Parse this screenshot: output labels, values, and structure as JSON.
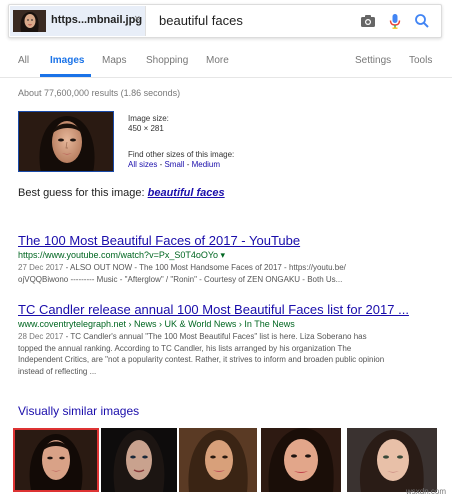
{
  "search": {
    "chip_label": "https...mbnail.jpg",
    "chip_close": "×",
    "query": "beautiful faces",
    "icons": [
      "camera-icon",
      "microphone-icon",
      "search-icon"
    ]
  },
  "tabs": [
    {
      "label": "All",
      "active": false
    },
    {
      "label": "Images",
      "active": true
    },
    {
      "label": "Maps",
      "active": false
    },
    {
      "label": "Shopping",
      "active": false
    },
    {
      "label": "More",
      "active": false
    },
    {
      "label": "Settings",
      "active": false
    },
    {
      "label": "Tools",
      "active": false
    }
  ],
  "stats": "About 77,600,000 results (1.86 seconds)",
  "query_image": {
    "size_label": "Image size:",
    "size_value": "450 × 281",
    "find_other": "Find other sizes of this image:",
    "all_sizes": "All sizes",
    "sep": " - ",
    "small": "Small",
    "medium": "Medium"
  },
  "best_guess": {
    "prefix": "Best guess for this image: ",
    "link": "beautiful faces"
  },
  "results": [
    {
      "title": "The 100 Most Beautiful Faces of 2017 - YouTube",
      "url": "https://www.youtube.com/watch?v=Px_S0T4oOYo ▾",
      "date": "27 Dec 2017",
      "snippet_line1": " - ALSO OUT NOW - The 100 Most Handsome Faces of 2017 - https://youtu.be/",
      "snippet_line2": "ojVQQBiwono --------- Music - \"Afterglow\" / \"Ronin\" - Courtesy of ZEN ONGAKU - Both Us..."
    },
    {
      "title": "TC Candler release annual 100 Most Beautiful Faces list for 2017 ...",
      "url": "www.coventrytelegraph.net › News › UK & World News › In The News",
      "date": "28 Dec 2017",
      "snippet_line1": " - TC Candler's annual \"The 100 Most Beautiful Faces\" list is here. Liza Soberano has",
      "snippet_line2": "topped the annual ranking. According to TC Candler, his lists arranged by his organization The",
      "snippet_line3": "Independent Critics, are \"not a popularity contest. Rather, it strives to inform and broaden public opinion",
      "snippet_line4": "instead of reflecting ..."
    }
  ],
  "similar": {
    "title": "Visually similar images",
    "count": 5,
    "selected_index": 0
  },
  "watermark": "wsxdn.com"
}
